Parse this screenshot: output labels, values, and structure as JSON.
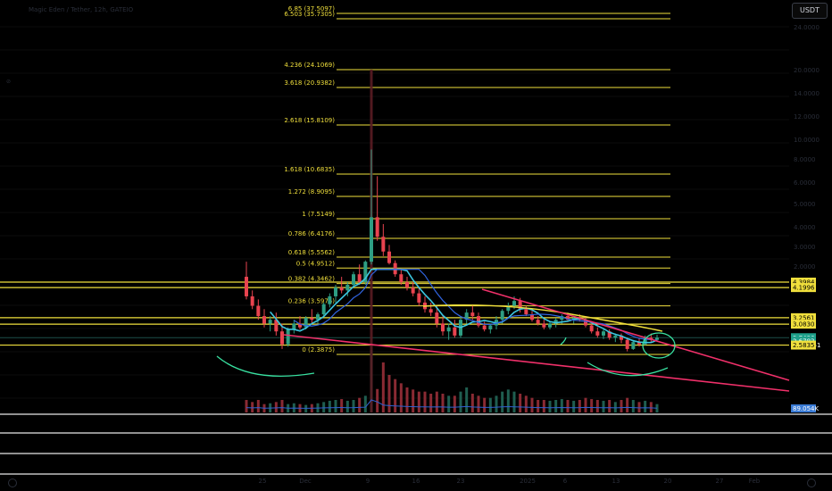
{
  "header": {
    "symbol_title": "Magic Eden / Tether, 12h, GATEIO",
    "currency_label": "USDT"
  },
  "side_marker": "⊘",
  "colors": {
    "background": "#000000",
    "fib_line": "#f0df3c",
    "trendline": "#f0306a",
    "bull_candle": "#2e9e83",
    "bear_candle": "#e8434f",
    "ma_cyan": "#3cc6e0",
    "ma_blue": "#3064e0",
    "ma_yellow": "#f0df3c",
    "annotation": "#38e0a0",
    "vol_ma": "#3060d0"
  },
  "chart_data": {
    "type": "candlestick",
    "title": "Magic Eden / Tether, 12h, GATEIO",
    "y_scale": "log",
    "ylim": [
      1.75,
      40
    ],
    "y_ticks": [
      "24.0000",
      "20.0000",
      "14.0000",
      "12.0000",
      "10.0000",
      "8.0000",
      "6.0000",
      "5.0000",
      "4.0000",
      "3.0000",
      "2.0000"
    ],
    "x_ticks": [
      "25",
      "Dec",
      "9",
      "16",
      "23",
      "2025",
      "6",
      "13",
      "20",
      "27",
      "Feb"
    ],
    "fib_levels": [
      {
        "label": "6.85 (37.5097)",
        "value": 37.5097
      },
      {
        "label": "6.503 (35.7305)",
        "value": 35.7305
      },
      {
        "label": "4.236 (24.1069)",
        "value": 24.1069
      },
      {
        "label": "3.618 (20.9382)",
        "value": 20.9382
      },
      {
        "label": "2.618 (15.8109)",
        "value": 15.8109
      },
      {
        "label": "1.618 (10.6835)",
        "value": 10.6835
      },
      {
        "label": "1.272 (8.9095)",
        "value": 8.9095
      },
      {
        "label": "1 (7.5149)",
        "value": 7.5149
      },
      {
        "label": "0.786 (6.4176)",
        "value": 6.4176
      },
      {
        "label": "0.618 (5.5562)",
        "value": 5.5562
      },
      {
        "label": "0.5 (4.9512)",
        "value": 4.9512
      },
      {
        "label": "0.382 (4.3462)",
        "value": 4.3462
      },
      {
        "label": "0.236 (3.5976)",
        "value": 3.5976
      },
      {
        "label": "0 (2.3875)",
        "value": 2.3875
      }
    ],
    "horizontal_levels": [
      4.3984,
      4.1996,
      3.2561,
      3.083,
      2.5835
    ],
    "price_tags": [
      {
        "value": 4.3984,
        "text": "4.3984",
        "style": "yellow"
      },
      {
        "value": 4.1996,
        "text": "4.1996",
        "style": "yellow"
      },
      {
        "value": 3.2561,
        "text": "3.2561",
        "style": "yellow"
      },
      {
        "value": 3.083,
        "text": "3.0830",
        "style": "yellow"
      },
      {
        "value": 2.7496,
        "text": "2.7496",
        "style": "teal"
      },
      {
        "value": 2.62,
        "text": "10:16:51",
        "style": "countdown"
      },
      {
        "value": 2.6783,
        "text": "2.6783",
        "style": "teal"
      },
      {
        "value": 2.5835,
        "text": "2.5835",
        "style": "yellow"
      }
    ],
    "volume_tag": "89.054K",
    "last_price": 2.7496,
    "candles": [
      [
        4.6,
        5.2,
        3.8,
        3.9
      ],
      [
        3.9,
        4.1,
        3.5,
        3.6
      ],
      [
        3.6,
        3.8,
        3.2,
        3.3
      ],
      [
        3.3,
        3.5,
        3.0,
        3.1
      ],
      [
        3.1,
        3.3,
        2.9,
        3.2
      ],
      [
        3.2,
        3.4,
        2.8,
        2.9
      ],
      [
        2.9,
        3.1,
        2.5,
        2.6
      ],
      [
        2.6,
        3.0,
        2.55,
        2.95
      ],
      [
        2.95,
        3.2,
        2.85,
        3.1
      ],
      [
        3.1,
        3.3,
        2.95,
        3.0
      ],
      [
        3.0,
        3.3,
        2.95,
        3.25
      ],
      [
        3.25,
        3.5,
        3.1,
        3.2
      ],
      [
        3.2,
        3.4,
        3.1,
        3.35
      ],
      [
        3.35,
        3.7,
        3.3,
        3.65
      ],
      [
        3.65,
        4.0,
        3.55,
        3.9
      ],
      [
        3.9,
        4.3,
        3.7,
        4.2
      ],
      [
        4.2,
        4.6,
        4.0,
        4.1
      ],
      [
        4.1,
        4.4,
        3.9,
        4.3
      ],
      [
        4.3,
        4.8,
        4.2,
        4.7
      ],
      [
        4.7,
        5.0,
        4.3,
        4.4
      ],
      [
        4.4,
        5.3,
        4.3,
        5.2
      ],
      [
        5.2,
        13.0,
        5.0,
        7.6
      ],
      [
        7.6,
        10.5,
        6.3,
        6.5
      ],
      [
        6.5,
        7.2,
        5.6,
        5.8
      ],
      [
        5.8,
        6.1,
        5.0,
        5.1
      ],
      [
        5.1,
        5.3,
        4.6,
        4.7
      ],
      [
        4.7,
        4.9,
        4.3,
        4.4
      ],
      [
        4.4,
        4.6,
        4.1,
        4.2
      ],
      [
        4.2,
        4.4,
        3.9,
        4.0
      ],
      [
        4.0,
        4.2,
        3.6,
        3.7
      ],
      [
        3.7,
        3.9,
        3.4,
        3.5
      ],
      [
        3.5,
        3.7,
        3.3,
        3.4
      ],
      [
        3.4,
        3.6,
        3.0,
        3.1
      ],
      [
        3.1,
        3.3,
        2.8,
        2.9
      ],
      [
        2.9,
        3.1,
        2.7,
        3.0
      ],
      [
        3.0,
        3.2,
        2.75,
        2.8
      ],
      [
        2.8,
        3.3,
        2.75,
        3.2
      ],
      [
        3.2,
        3.5,
        3.1,
        3.4
      ],
      [
        3.4,
        3.6,
        3.2,
        3.3
      ],
      [
        3.3,
        3.4,
        3.0,
        3.05
      ],
      [
        3.05,
        3.15,
        2.9,
        2.95
      ],
      [
        2.95,
        3.1,
        2.85,
        3.05
      ],
      [
        3.05,
        3.3,
        2.95,
        3.2
      ],
      [
        3.2,
        3.5,
        3.1,
        3.45
      ],
      [
        3.45,
        3.7,
        3.35,
        3.6
      ],
      [
        3.6,
        3.9,
        3.5,
        3.75
      ],
      [
        3.75,
        3.85,
        3.4,
        3.5
      ],
      [
        3.5,
        3.6,
        3.3,
        3.35
      ],
      [
        3.35,
        3.45,
        3.15,
        3.2
      ],
      [
        3.2,
        3.3,
        3.05,
        3.1
      ],
      [
        3.1,
        3.2,
        2.95,
        3.0
      ],
      [
        3.0,
        3.15,
        2.95,
        3.1
      ],
      [
        3.1,
        3.25,
        3.0,
        3.2
      ],
      [
        3.2,
        3.35,
        3.1,
        3.3
      ],
      [
        3.3,
        3.4,
        3.15,
        3.2
      ],
      [
        3.2,
        3.3,
        3.1,
        3.25
      ],
      [
        3.25,
        3.35,
        3.15,
        3.2
      ],
      [
        3.2,
        3.3,
        3.0,
        3.05
      ],
      [
        3.05,
        3.1,
        2.85,
        2.9
      ],
      [
        2.9,
        3.0,
        2.75,
        2.8
      ],
      [
        2.8,
        2.95,
        2.72,
        2.9
      ],
      [
        2.9,
        2.95,
        2.7,
        2.75
      ],
      [
        2.75,
        2.85,
        2.65,
        2.8
      ],
      [
        2.8,
        2.85,
        2.62,
        2.7
      ],
      [
        2.7,
        2.75,
        2.45,
        2.5
      ],
      [
        2.5,
        2.7,
        2.48,
        2.65
      ],
      [
        2.65,
        2.75,
        2.55,
        2.6
      ],
      [
        2.6,
        2.8,
        2.58,
        2.75
      ],
      [
        2.75,
        2.85,
        2.65,
        2.7
      ],
      [
        2.7,
        2.82,
        2.66,
        2.75
      ]
    ],
    "volumes": [
      0.3,
      0.25,
      0.3,
      0.2,
      0.22,
      0.25,
      0.3,
      0.2,
      0.22,
      0.2,
      0.18,
      0.2,
      0.22,
      0.25,
      0.28,
      0.3,
      0.32,
      0.28,
      0.3,
      0.35,
      0.4,
      12.0,
      4.5,
      1.2,
      0.9,
      0.8,
      0.7,
      0.6,
      0.55,
      0.5,
      0.5,
      0.45,
      0.5,
      0.45,
      0.4,
      0.4,
      0.5,
      0.6,
      0.45,
      0.4,
      0.35,
      0.35,
      0.4,
      0.5,
      0.55,
      0.5,
      0.45,
      0.4,
      0.35,
      0.3,
      0.3,
      0.28,
      0.3,
      0.32,
      0.3,
      0.28,
      0.3,
      0.35,
      0.32,
      0.3,
      0.28,
      0.3,
      0.25,
      0.3,
      0.35,
      0.3,
      0.25,
      0.28,
      0.25,
      0.2
    ]
  }
}
